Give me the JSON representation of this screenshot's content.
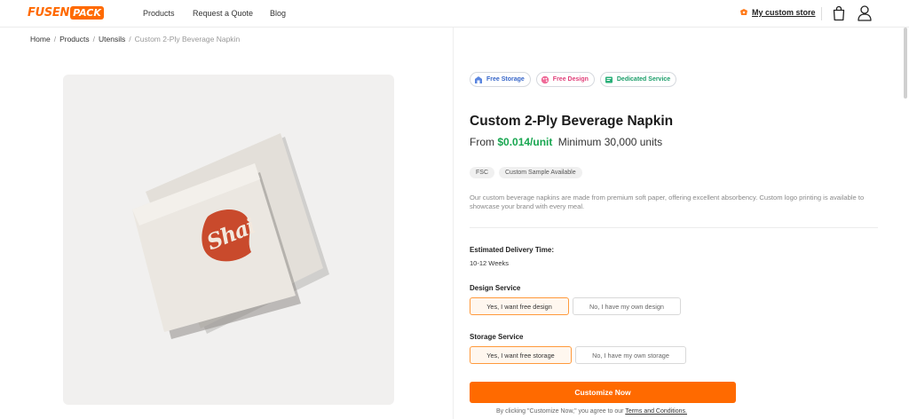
{
  "brand": {
    "logo_left": "FUSEN",
    "logo_right": "PACK",
    "accent_color": "#ff6a00"
  },
  "nav": {
    "products": "Products",
    "quote": "Request a Quote",
    "blog": "Blog"
  },
  "header": {
    "store_label": "My custom store",
    "icons": [
      "store-icon",
      "cart-icon",
      "user-icon"
    ]
  },
  "breadcrumb": [
    {
      "label": "Home"
    },
    {
      "label": "Products"
    },
    {
      "label": "Utensils"
    },
    {
      "label": "Custom 2-Ply Beverage Napkin"
    }
  ],
  "product_image": {
    "print_text": "Shai"
  },
  "badges": [
    {
      "label": "Free Storage",
      "icon": "storage-icon",
      "color": "#3766c9"
    },
    {
      "label": "Free Design",
      "icon": "palette-icon",
      "color": "#e0407a"
    },
    {
      "label": "Dedicated Service",
      "icon": "service-icon",
      "color": "#1c9e6a"
    }
  ],
  "product": {
    "title": "Custom 2-Ply Beverage Napkin",
    "price_prefix": "From",
    "price": "$0.014/unit",
    "minimum": "Minimum 30,000 units",
    "price_color": "#18a650",
    "tags": [
      "FSC",
      "Custom Sample Available"
    ],
    "description": "Our custom beverage napkins are made from premium soft paper, offering excellent absorbency. Custom logo printing is available to showcase your brand with every meal."
  },
  "delivery": {
    "label": "Estimated Delivery Time:",
    "value": "10-12 Weeks"
  },
  "design_service": {
    "label": "Design Service",
    "options": [
      {
        "label": "Yes, I want free design",
        "selected": true
      },
      {
        "label": "No, I have my own design",
        "selected": false
      }
    ]
  },
  "storage_service": {
    "label": "Storage Service",
    "options": [
      {
        "label": "Yes, I want free storage",
        "selected": true
      },
      {
        "label": "No, I have my own storage",
        "selected": false
      }
    ]
  },
  "cta": {
    "label": "Customize Now"
  },
  "terms": {
    "prefix": "By clicking \"Customize Now,\" you agree to our",
    "link": "Terms and Conditions."
  }
}
